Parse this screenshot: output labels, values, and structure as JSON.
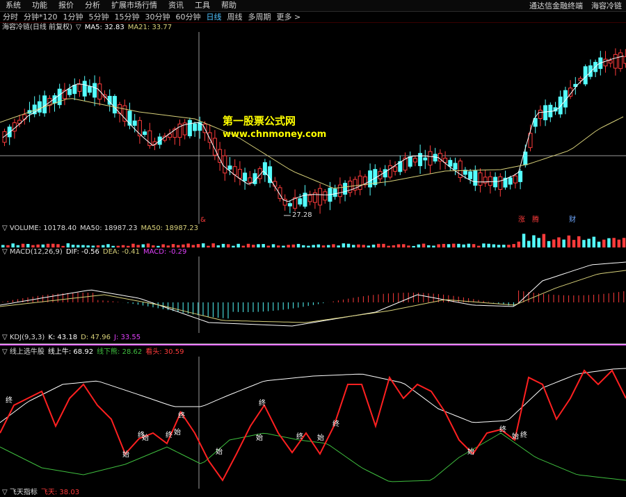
{
  "menu": {
    "items": [
      "系统",
      "功能",
      "报价",
      "分析",
      "扩展市场行情",
      "资讯",
      "工具",
      "帮助"
    ],
    "right": [
      "通达信金融终端",
      "海容冷链"
    ]
  },
  "periods": {
    "items": [
      "分时",
      "分钟*120",
      "1分钟",
      "5分钟",
      "15分钟",
      "30分钟",
      "60分钟",
      "日线",
      "周线",
      "多周期",
      "更多 >"
    ],
    "active": "日线"
  },
  "main_panel": {
    "title": "海容冷链(日线 前复权)",
    "indicator_marker": "▽",
    "ma5": "MA5: 32.83",
    "ma21": "MA21: 33.77",
    "low_label": "27.28",
    "bottom_marks": [
      "涨",
      "腾",
      "财"
    ],
    "left_mark": "&"
  },
  "volume_panel": {
    "title": "▽ VOLUME: 10178.40",
    "ma1": "MA50: 18987.23",
    "ma2": "MA50: 18987.23"
  },
  "macd_panel": {
    "title": "▽ MACD(12,26,9)",
    "dif": "DIF: -0.56",
    "dea": "DEA: -0.41",
    "macd": "MACD: -0.29"
  },
  "kdj_panel": {
    "title": "▽ KDJ(9,3,3)",
    "k": "K: 43.18",
    "d": "D: 47.96",
    "j": "J: 33.55"
  },
  "line_panel": {
    "title": "▽ 线上选牛股",
    "up": "线上牛: 68.92",
    "down": "线下熊: 28.62",
    "head": "看头: 30.59",
    "marks_end": "终",
    "marks_start": "始"
  },
  "fly_panel": {
    "title": "▽ 飞天指标",
    "value": "飞天: 38.03"
  },
  "watermark": {
    "title": "第一股票公式网",
    "url": "www.chnmoney.com"
  },
  "colors": {
    "up": "#ff3b3b",
    "down": "#54ffff",
    "ma5": "#ffffff",
    "ma21": "#d8d17a",
    "accent": "#4fc3ff",
    "watermark": "#ffff00"
  }
}
